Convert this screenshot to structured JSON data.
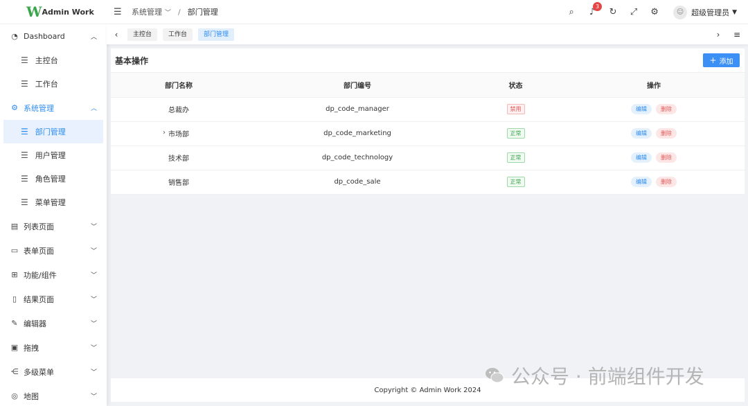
{
  "logo": {
    "mark": "W",
    "text": "Admin Work"
  },
  "sidebar": {
    "items": [
      {
        "label": "Dashboard",
        "icon": "dashboard-icon",
        "glyph": "◔",
        "chevron": "︿",
        "open": false
      },
      {
        "label": "主控台",
        "sub": true,
        "glyph": "☰"
      },
      {
        "label": "工作台",
        "sub": true,
        "glyph": "☰"
      },
      {
        "label": "系统管理",
        "icon": "gear-icon",
        "glyph": "⚙",
        "chevron": "︿",
        "open": true
      },
      {
        "label": "部门管理",
        "sub": true,
        "glyph": "☰",
        "active": true
      },
      {
        "label": "用户管理",
        "sub": true,
        "glyph": "☰"
      },
      {
        "label": "角色管理",
        "sub": true,
        "glyph": "☰"
      },
      {
        "label": "菜单管理",
        "sub": true,
        "glyph": "☰"
      },
      {
        "label": "列表页面",
        "icon": "list-icon",
        "glyph": "▤",
        "chevron": "﹀"
      },
      {
        "label": "表单页面",
        "icon": "form-icon",
        "glyph": "▭",
        "chevron": "﹀"
      },
      {
        "label": "功能/组件",
        "icon": "grid-icon",
        "glyph": "⊞",
        "chevron": "﹀"
      },
      {
        "label": "结果页面",
        "icon": "result-icon",
        "glyph": "▯",
        "chevron": "﹀"
      },
      {
        "label": "编辑器",
        "icon": "pen-icon",
        "glyph": "✎",
        "chevron": "﹀"
      },
      {
        "label": "拖拽",
        "icon": "drag-icon",
        "glyph": "▣",
        "chevron": "﹀"
      },
      {
        "label": "多级菜单",
        "icon": "tree-icon",
        "glyph": "⋲",
        "chevron": "﹀"
      },
      {
        "label": "地图",
        "icon": "map-icon",
        "glyph": "◎",
        "chevron": "﹀"
      }
    ]
  },
  "header": {
    "breadcrumb": {
      "parent": "系统管理",
      "separator": "/",
      "current": "部门管理"
    },
    "notification_count": "3",
    "user_name": "超级管理员"
  },
  "tabs": [
    {
      "label": "主控台",
      "active": false
    },
    {
      "label": "工作台",
      "active": false
    },
    {
      "label": "部门管理",
      "active": true
    }
  ],
  "card": {
    "title": "基本操作",
    "add_label": "添加",
    "columns": [
      "部门名称",
      "部门编号",
      "状态",
      "操作"
    ],
    "rows": [
      {
        "name": "总裁办",
        "code": "dp_code_manager",
        "status": "禁用",
        "status_type": "disabled",
        "expandable": false
      },
      {
        "name": "市场部",
        "code": "dp_code_marketing",
        "status": "正常",
        "status_type": "normal",
        "expandable": true
      },
      {
        "name": "技术部",
        "code": "dp_code_technology",
        "status": "正常",
        "status_type": "normal",
        "expandable": false
      },
      {
        "name": "销售部",
        "code": "dp_code_sale",
        "status": "正常",
        "status_type": "normal",
        "expandable": false
      }
    ],
    "edit_label": "编辑",
    "delete_label": "删除"
  },
  "footer": {
    "copyright": "Copyright © Admin Work 2024"
  },
  "watermark": {
    "text": "公众号 · 前端组件开发"
  },
  "colors": {
    "primary": "#2d8cf0",
    "add_button": "#3b8ff5",
    "danger": "#e05a5a",
    "success": "#3aa54a",
    "logo": "#3aa54a"
  }
}
